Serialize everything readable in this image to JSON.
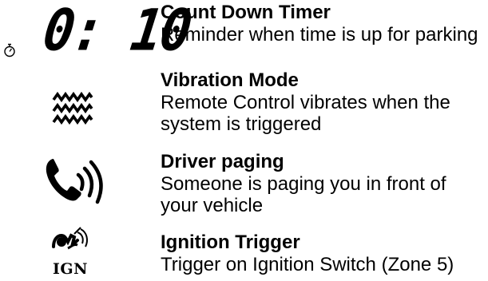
{
  "features": [
    {
      "icon": "stopwatch-icon",
      "display": "0: 10",
      "title": "Count Down Timer",
      "description": "Reminder when time is up for parking"
    },
    {
      "icon": "vibration-waves-icon",
      "title": "Vibration Mode",
      "description": "Remote Control vibrates when the system is triggered"
    },
    {
      "icon": "phone-paging-icon",
      "title": "Driver paging",
      "description": "Someone is paging you in front of your vehicle"
    },
    {
      "icon": "ignition-key-icon",
      "icon_label": "IGN",
      "title": "Ignition Trigger",
      "description": "Trigger on Ignition Switch (Zone 5)"
    }
  ]
}
